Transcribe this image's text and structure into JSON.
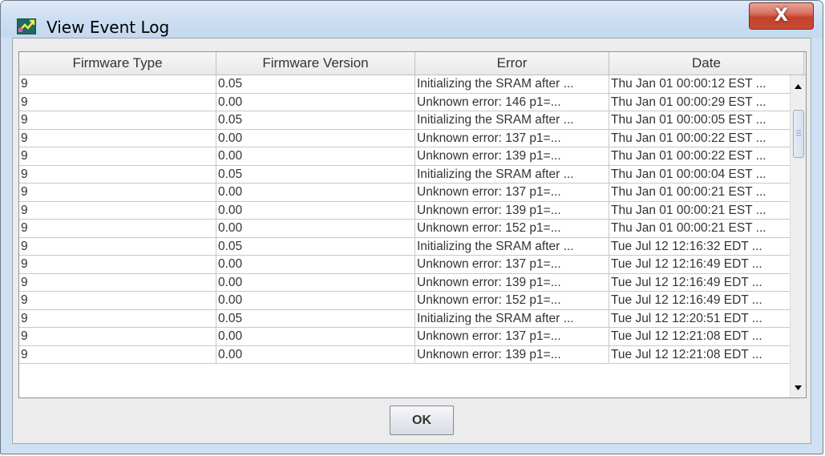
{
  "window": {
    "title": "View Event Log",
    "close_label": "X"
  },
  "table": {
    "columns": [
      "Firmware Type",
      "Firmware Version",
      "Error",
      "Date"
    ],
    "rows": [
      [
        "9",
        "0.05",
        "Initializing the SRAM after ...",
        "Thu Jan 01 00:00:12 EST ..."
      ],
      [
        "9",
        "0.00",
        "Unknown error: 146  p1=...",
        "Thu Jan 01 00:00:29 EST ..."
      ],
      [
        "9",
        "0.05",
        "Initializing the SRAM after ...",
        "Thu Jan 01 00:00:05 EST ..."
      ],
      [
        "9",
        "0.00",
        "Unknown error: 137  p1=...",
        "Thu Jan 01 00:00:22 EST ..."
      ],
      [
        "9",
        "0.00",
        "Unknown error: 139  p1=...",
        "Thu Jan 01 00:00:22 EST ..."
      ],
      [
        "9",
        "0.05",
        "Initializing the SRAM after ...",
        "Thu Jan 01 00:00:04 EST ..."
      ],
      [
        "9",
        "0.00",
        "Unknown error: 137  p1=...",
        "Thu Jan 01 00:00:21 EST ..."
      ],
      [
        "9",
        "0.00",
        "Unknown error: 139  p1=...",
        "Thu Jan 01 00:00:21 EST ..."
      ],
      [
        "9",
        "0.00",
        "Unknown error: 152  p1=...",
        "Thu Jan 01 00:00:21 EST ..."
      ],
      [
        "9",
        "0.05",
        "Initializing the SRAM after ...",
        "Tue Jul 12 12:16:32 EDT ..."
      ],
      [
        "9",
        "0.00",
        "Unknown error: 137  p1=...",
        "Tue Jul 12 12:16:49 EDT ..."
      ],
      [
        "9",
        "0.00",
        "Unknown error: 139  p1=...",
        "Tue Jul 12 12:16:49 EDT ..."
      ],
      [
        "9",
        "0.00",
        "Unknown error: 152  p1=...",
        "Tue Jul 12 12:16:49 EDT ..."
      ],
      [
        "9",
        "0.05",
        "Initializing the SRAM after ...",
        "Tue Jul 12 12:20:51 EDT ..."
      ],
      [
        "9",
        "0.00",
        "Unknown error: 137  p1=...",
        "Tue Jul 12 12:21:08 EDT ..."
      ],
      [
        "9",
        "0.00",
        "Unknown error: 139  p1=...",
        "Tue Jul 12 12:21:08 EDT ..."
      ]
    ]
  },
  "footer": {
    "ok_label": "OK"
  },
  "icons": {
    "app_icon": "app-icon",
    "scroll_up": "scroll-up-arrow-icon",
    "scroll_down": "scroll-down-arrow-icon"
  },
  "colors": {
    "accent": "#c2422c",
    "window_frame": "#cfe0f3",
    "content_bg": "#ececec"
  }
}
